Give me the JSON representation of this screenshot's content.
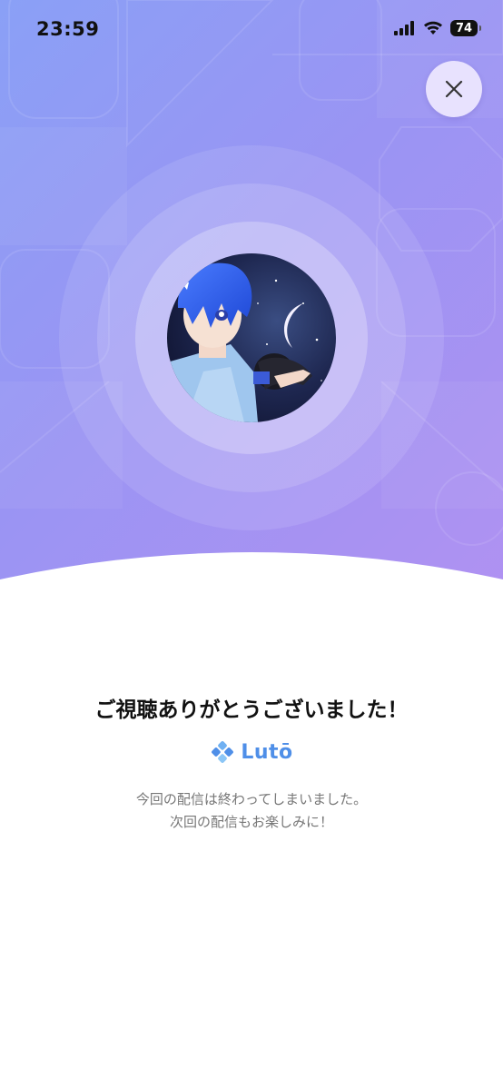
{
  "status_bar": {
    "time": "23:59",
    "battery": "74"
  },
  "icons": {
    "close": "close-icon",
    "signal": "cellular-signal-icon",
    "wifi": "wifi-icon",
    "battery": "battery-icon",
    "logo": "luto-logo-icon"
  },
  "end_screen": {
    "title": "ご視聴ありがとうございました！",
    "brand": "Lutō",
    "message_line1": "今回の配信は終わってしまいました。",
    "message_line2": "次回の配信もお楽しみに！"
  },
  "colors": {
    "gradient_start": "#8aa0f6",
    "gradient_end": "#b191f2",
    "brand": "#4f8fe8",
    "title": "#111111",
    "message": "#777777"
  }
}
